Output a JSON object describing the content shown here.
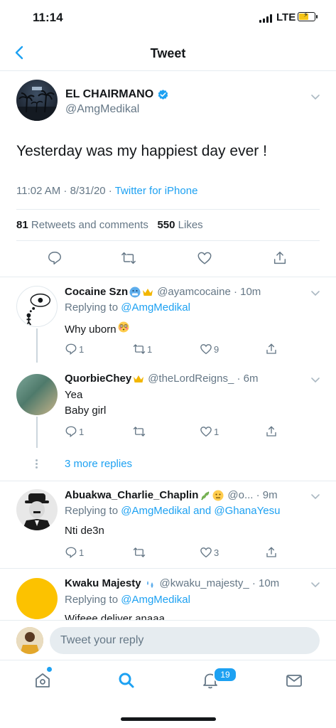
{
  "status_bar": {
    "time": "11:14",
    "network": "LTE",
    "battery_level": 0.6
  },
  "nav": {
    "title": "Tweet"
  },
  "main_tweet": {
    "author_name": "EL CHAIRMANO",
    "author_handle": "@AmgMedikal",
    "text": "Yesterday was my happiest day ever !",
    "timestamp": "11:02 AM · 8/31/20 · ",
    "source": "Twitter for iPhone",
    "retweets_count": "81",
    "retweets_label": "Retweets and comments",
    "likes_count": "550",
    "likes_label": "Likes"
  },
  "replies": [
    {
      "name": "Cocaine Szn",
      "handle": "@ayamcocaine · 10m",
      "replying_prefix": "Replying to ",
      "replying_to": "@AmgMedikal",
      "body_lines": [
        "Why uborn"
      ],
      "reply_count": "1",
      "retweet_count": "1",
      "like_count": "9"
    },
    {
      "name": "QuorbieChey",
      "handle": "@theLordReigns_ · 6m",
      "body_lines": [
        "Yea",
        "Baby girl"
      ],
      "reply_count": "1",
      "retweet_count": "",
      "like_count": "1"
    },
    {
      "name": "Abuakwa_Charlie_Chaplin",
      "handle": "@o... · 9m",
      "replying_prefix": "Replying to ",
      "replying_to": "@AmgMedikal and @GhanaYesu",
      "body_lines": [
        "Nti de3n"
      ],
      "reply_count": "1",
      "retweet_count": "",
      "like_count": "3"
    },
    {
      "name": "Kwaku Majesty",
      "handle": "@kwaku_majesty_ · 10m",
      "replying_prefix": "Replying to ",
      "replying_to": "@AmgMedikal",
      "body_lines": [
        "Wifeee deliver anaaa"
      ]
    }
  ],
  "more_replies": "3 more replies",
  "compose": {
    "placeholder": "Tweet your reply"
  },
  "tab_bar": {
    "notifications_badge": "19"
  },
  "colors": {
    "accent": "#1da1f2",
    "text": "#14171a",
    "secondary": "#657786",
    "border": "#e6ecf0"
  }
}
